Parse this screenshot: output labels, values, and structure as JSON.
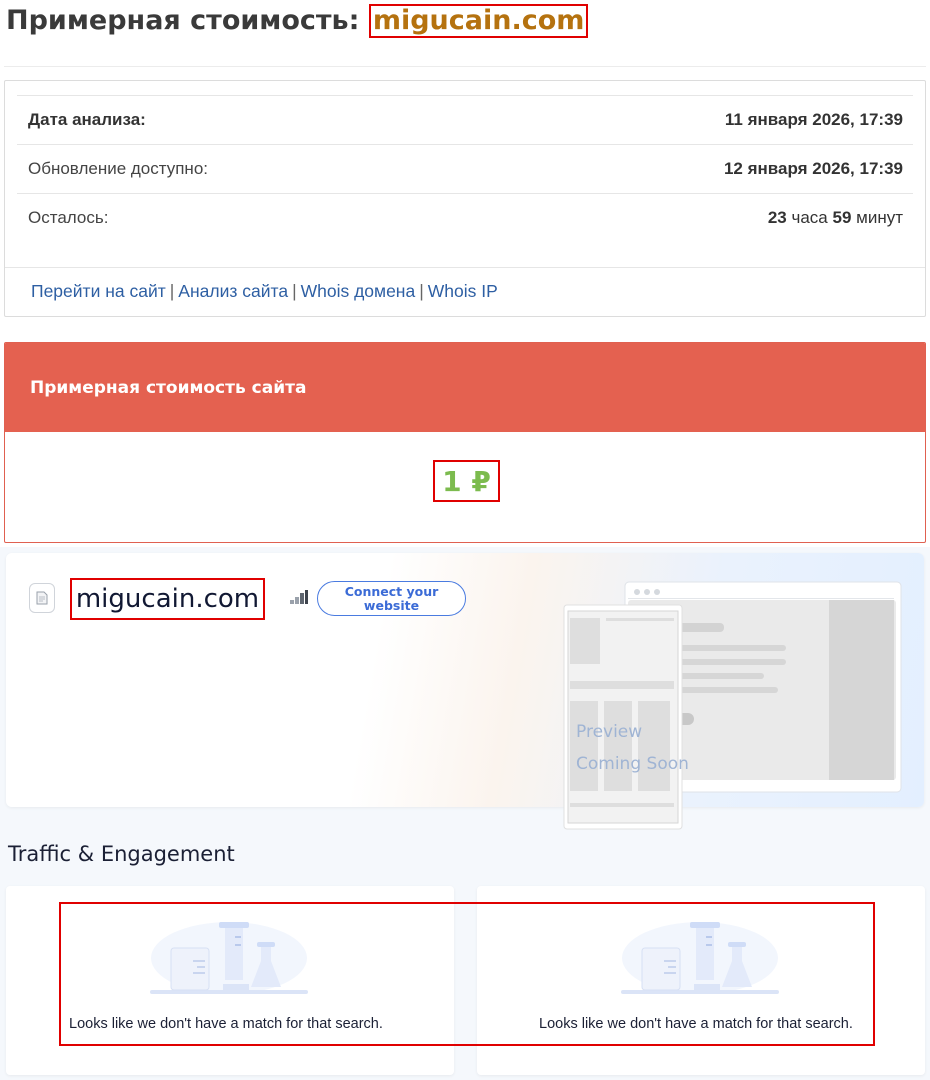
{
  "header": {
    "title_prefix": "Примерная стоимость:",
    "domain": "migucain.com"
  },
  "info": {
    "rows": [
      {
        "label": "Дата анализа:",
        "value": "11 января 2026, 17:39"
      },
      {
        "label": "Обновление доступно:",
        "value": "12 января 2026, 17:39"
      },
      {
        "label": "Осталось:",
        "hours": "23",
        "hours_unit": "часа",
        "minutes": "59",
        "minutes_unit": "минут"
      }
    ],
    "links": [
      "Перейти на сайт",
      "Анализ сайта",
      "Whois домена",
      "Whois IP"
    ],
    "link_separator": "|"
  },
  "cost": {
    "heading": "Примерная стоимость сайта",
    "value": "1 ₽"
  },
  "site": {
    "name": "migucain.com",
    "connect_label": "Connect your website",
    "preview_text": [
      "Preview",
      "Coming Soon"
    ]
  },
  "traffic": {
    "title": "Traffic & Engagement",
    "panels": [
      {
        "message": "Looks like we don't have a match for that search."
      },
      {
        "message": "Looks like we don't have a match for that search."
      }
    ]
  },
  "colors": {
    "accent_red": "#e46150",
    "domain_orange": "#b5720f",
    "cost_green": "#7cbb4e",
    "link_blue": "#2e5fa3"
  }
}
